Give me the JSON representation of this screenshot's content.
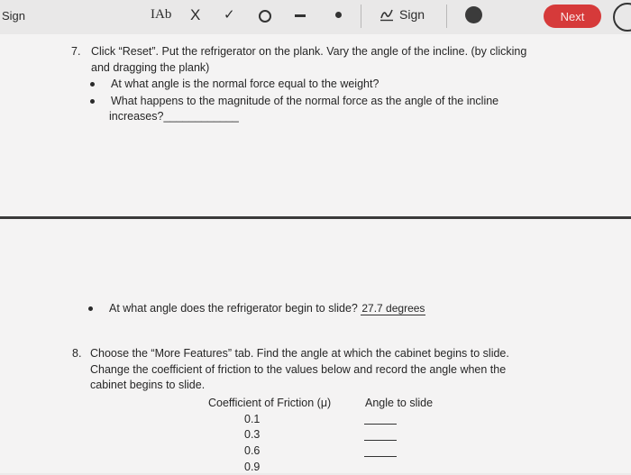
{
  "toolbar": {
    "sign_left": "Sign",
    "textbox_label": "IAb",
    "x_label": "X",
    "check_label": "✓",
    "sign_right": "Sign",
    "next_label": "Next"
  },
  "q7": {
    "number": "7.",
    "line1": "Click “Reset”. Put the refrigerator on the plank. Vary the angle of the incline. (by clicking",
    "line2": "and dragging the plank)",
    "bullet1": "At what angle is the normal force equal to the weight?",
    "bullet2_line1": "What happens to the magnitude of the normal force as the angle of the incline",
    "bullet2_line2": "increases?",
    "bullet2_blank": "____________",
    "bullet3": "At what angle does the refrigerator begin to slide?",
    "bullet3_answer": "27.7 degrees"
  },
  "q8": {
    "number": "8.",
    "line1": "Choose the “More Features” tab. Find the angle at which the cabinet begins to slide.",
    "line2": "Change the coefficient of friction to the values below and record the angle when the",
    "line3": "cabinet begins to slide.",
    "table": {
      "col1": "Coefficient of Friction (μ)",
      "col2": "Angle to slide",
      "rows": [
        "0.1",
        "0.3",
        "0.6",
        "0.9"
      ]
    }
  }
}
